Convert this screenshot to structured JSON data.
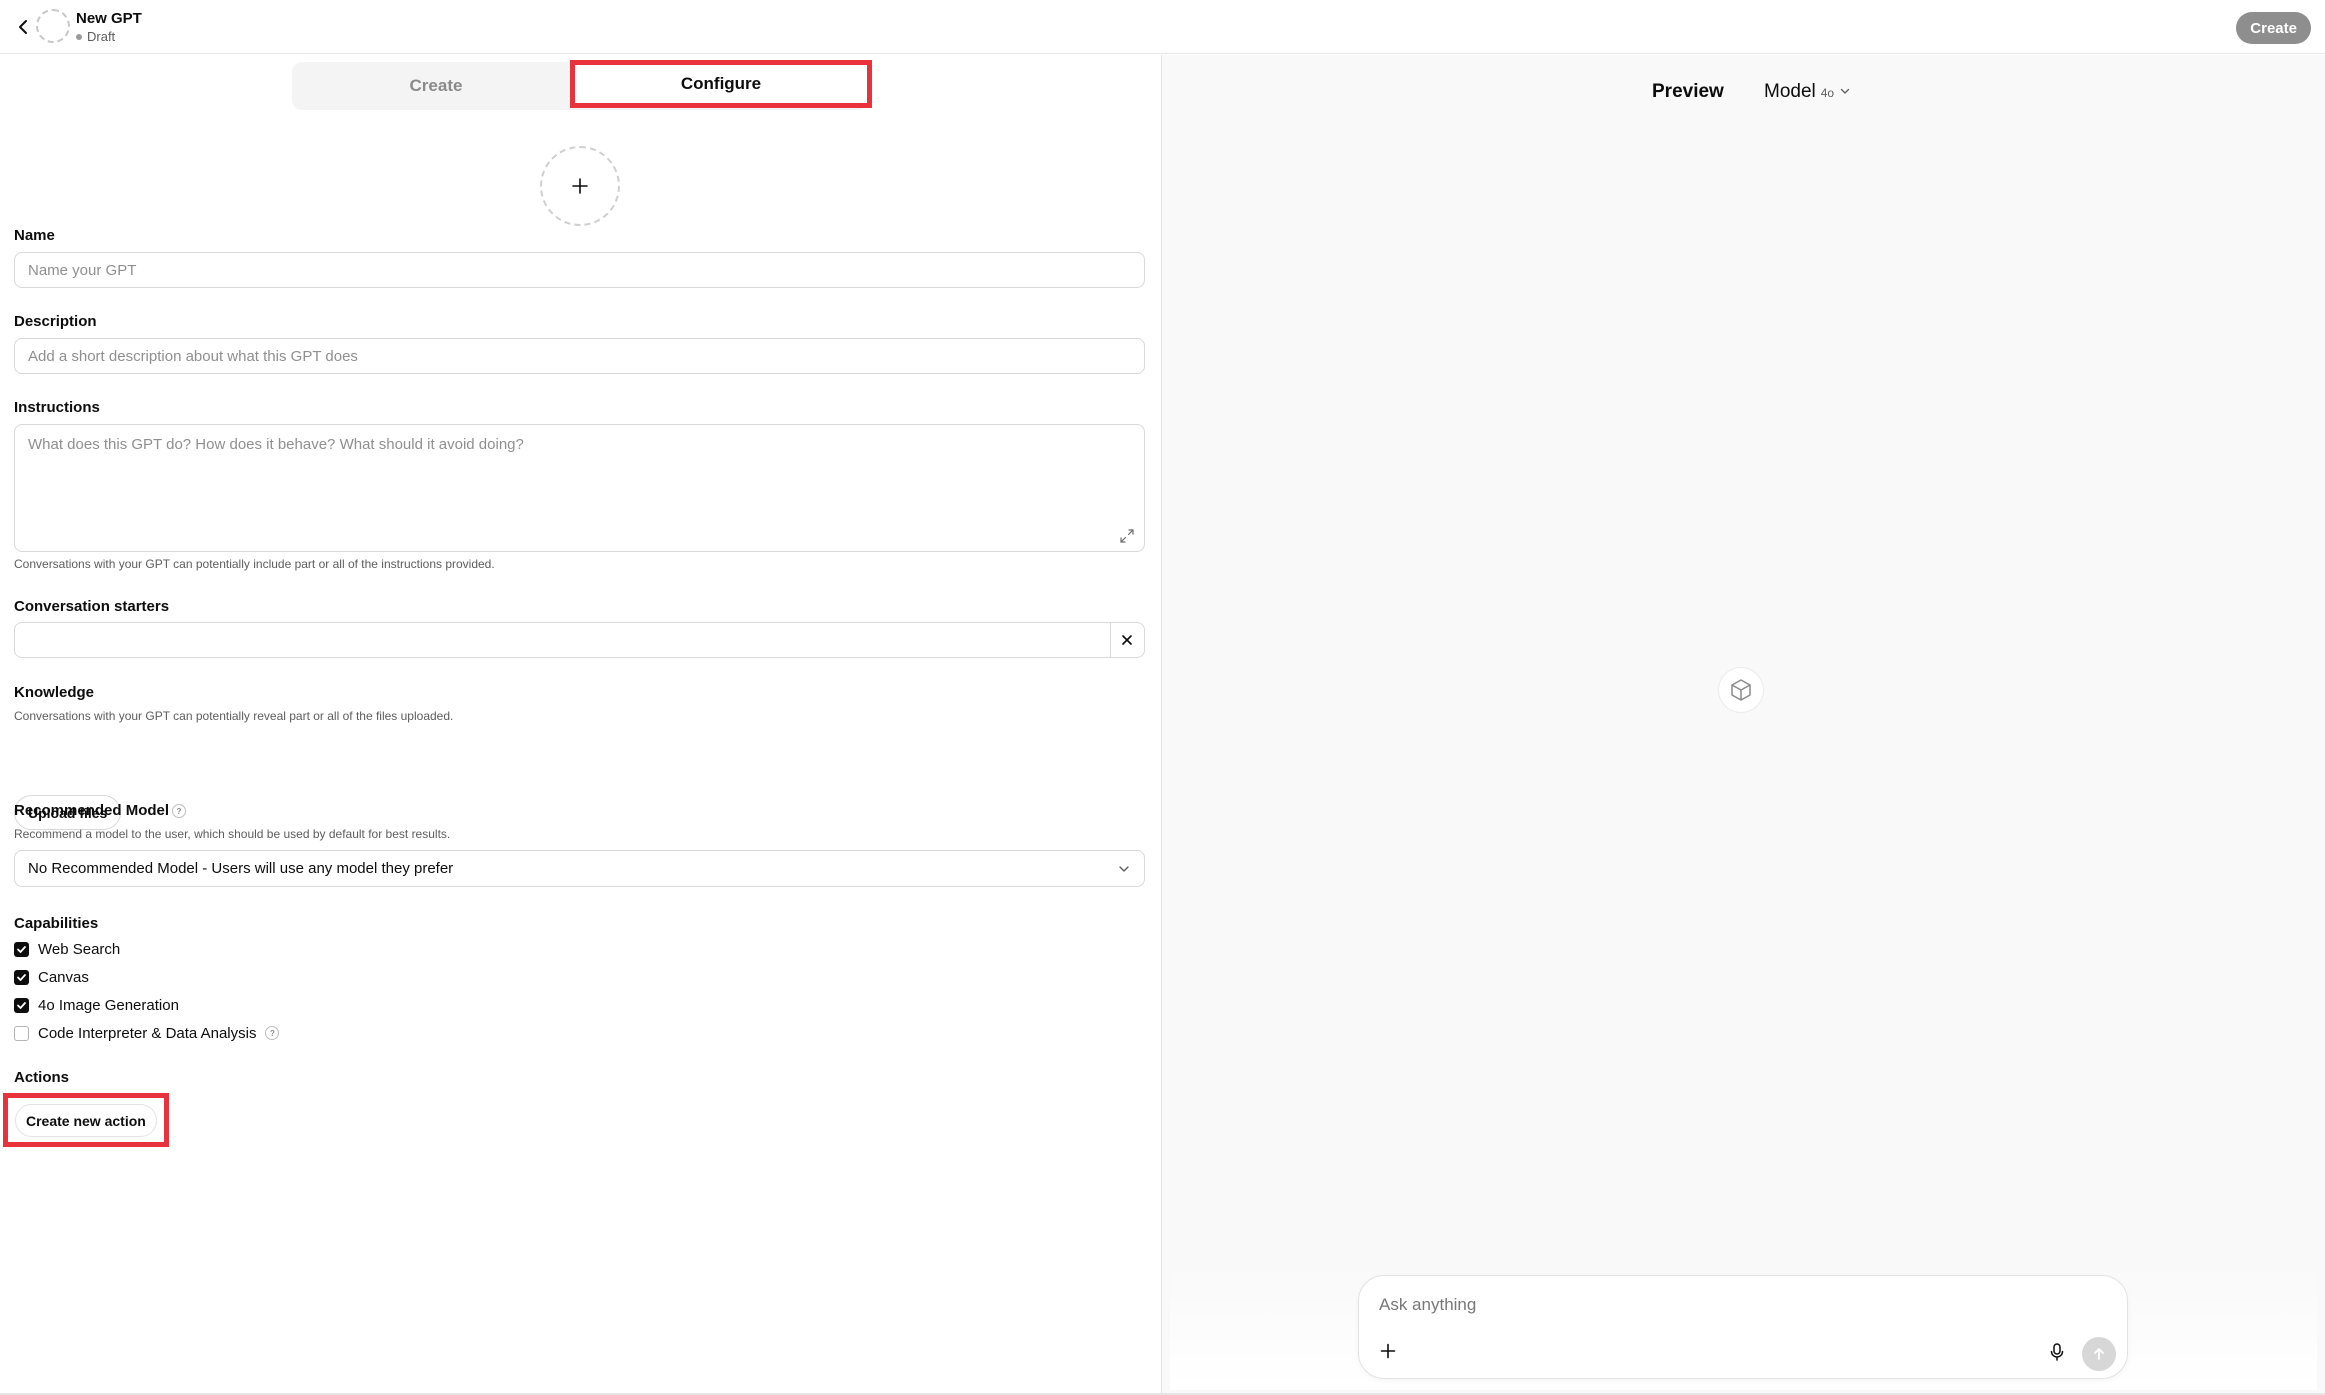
{
  "header": {
    "title": "New GPT",
    "status": "Draft",
    "publish_label": "Create"
  },
  "tabs": {
    "create": "Create",
    "configure": "Configure",
    "active": "Configure"
  },
  "form": {
    "name": {
      "label": "Name",
      "placeholder": "Name your GPT",
      "value": ""
    },
    "description": {
      "label": "Description",
      "placeholder": "Add a short description about what this GPT does",
      "value": ""
    },
    "instructions": {
      "label": "Instructions",
      "placeholder": "What does this GPT do? How does it behave? What should it avoid doing?",
      "hint": "Conversations with your GPT can potentially include part or all of the instructions provided."
    },
    "starters": {
      "label": "Conversation starters",
      "value": ""
    },
    "knowledge": {
      "label": "Knowledge",
      "hint": "Conversations with your GPT can potentially reveal part or all of the files uploaded.",
      "upload_label": "Upload files"
    },
    "recommended_model": {
      "label": "Recommended Model",
      "hint": "Recommend a model to the user, which should be used by default for best results.",
      "selected": "No Recommended Model - Users will use any model they prefer"
    },
    "capabilities": {
      "label": "Capabilities",
      "items": [
        {
          "label": "Web Search",
          "checked": true
        },
        {
          "label": "Canvas",
          "checked": true
        },
        {
          "label": "4o Image Generation",
          "checked": true
        },
        {
          "label": "Code Interpreter & Data Analysis",
          "checked": false
        }
      ]
    },
    "actions": {
      "label": "Actions",
      "create_label": "Create new action"
    }
  },
  "preview": {
    "title": "Preview",
    "model_label": "Model",
    "model_value": "4o",
    "composer_placeholder": "Ask anything"
  },
  "colors": {
    "highlight": "#e8323c",
    "publish_bg": "#8e8e8e",
    "checkbox_on": "#0d0d0d"
  }
}
